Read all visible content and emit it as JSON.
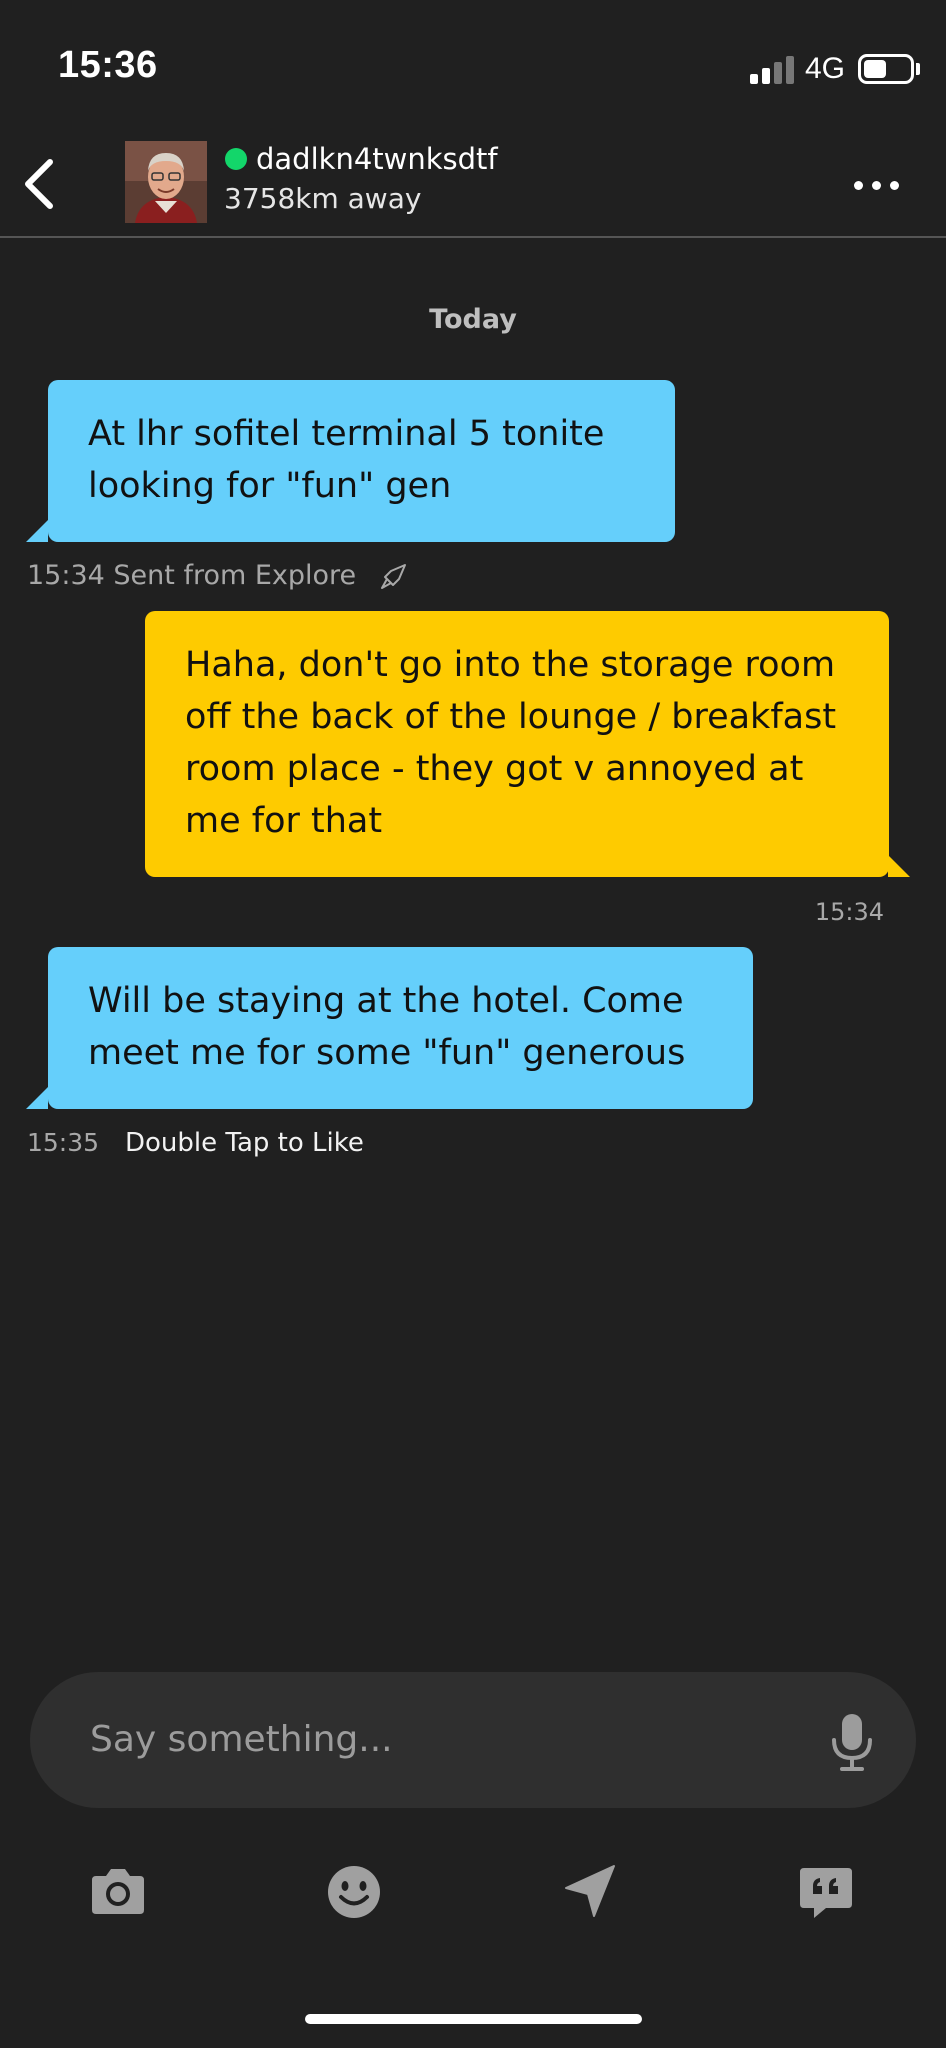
{
  "status_bar": {
    "time": "15:36",
    "network": "4G",
    "battery_fraction": 0.45
  },
  "header": {
    "username": "dadlkn4twnksdtf",
    "distance": "3758km away",
    "online": true,
    "online_color": "#13d66a"
  },
  "conversation": {
    "date_separator": "Today",
    "messages": [
      {
        "direction": "incoming",
        "lines": [
          "At lhr sofitel terminal 5 tonite",
          "looking for \"fun\" gen"
        ],
        "time": "15:34",
        "note": "Sent from Explore",
        "note_icon": "rocket-icon"
      },
      {
        "direction": "outgoing",
        "lines": [
          "Haha, don't go into the storage room",
          "off the back of the lounge / breakfast",
          "room place - they got v annoyed at",
          "me for that"
        ],
        "time": "15:34"
      },
      {
        "direction": "incoming",
        "lines": [
          "Will be staying at the hotel.  Come",
          "meet me for some \"fun\" generous"
        ],
        "time": "15:35",
        "note": "Double Tap to Like"
      }
    ]
  },
  "composer": {
    "placeholder": "Say something...",
    "mic_icon": "microphone-icon"
  },
  "toolbar": {
    "items": [
      "camera-icon",
      "emoji-icon",
      "location-icon",
      "saved-phrases-icon"
    ]
  },
  "colors": {
    "background": "#202020",
    "incoming_bubble": "#65cffb",
    "outgoing_bubble": "#fecb00",
    "input_background": "#2f2f2f"
  }
}
